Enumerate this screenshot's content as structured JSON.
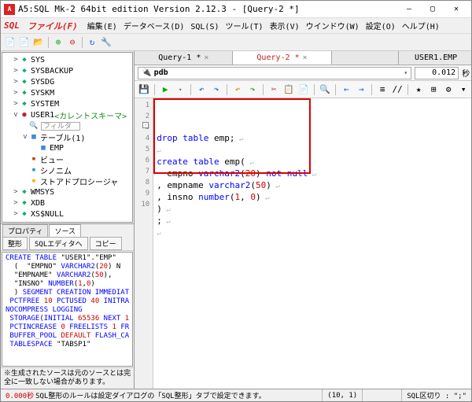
{
  "window": {
    "icon_letter": "A",
    "title": "A5:SQL Mk-2 64bit edition Version 2.12.3 - [Query-2 *]",
    "btn_min": "—",
    "btn_max": "▢",
    "btn_close": "✕"
  },
  "menubar": {
    "logo": "SQL",
    "items": [
      "ファイル(F)",
      "編集(E)",
      "データベース(D)",
      "SQL(S)",
      "ツール(T)",
      "表示(V)",
      "ウインドウ(W)",
      "設定(O)",
      "ヘルプ(H)"
    ]
  },
  "tree": {
    "nodes": [
      {
        "indent": 1,
        "tw": ">",
        "icon": "db",
        "label": "SYS"
      },
      {
        "indent": 1,
        "tw": ">",
        "icon": "db",
        "label": "SYSBACKUP"
      },
      {
        "indent": 1,
        "tw": ">",
        "icon": "db",
        "label": "SYSDG"
      },
      {
        "indent": 1,
        "tw": ">",
        "icon": "db",
        "label": "SYSKM"
      },
      {
        "indent": 1,
        "tw": ">",
        "icon": "db",
        "label": "SYSTEM"
      },
      {
        "indent": 1,
        "tw": "v",
        "icon": "user",
        "label": "USER1",
        "suffix": " <カレントスキーマ>",
        "suffixClass": "green-txt"
      },
      {
        "indent": 2,
        "tw": "",
        "icon": "lens",
        "label": "",
        "filter": "フィルタ"
      },
      {
        "indent": 2,
        "tw": "v",
        "icon": "tbl",
        "label": "テーブル(1)"
      },
      {
        "indent": 3,
        "tw": "",
        "icon": "tbl",
        "label": "EMP"
      },
      {
        "indent": 2,
        "tw": "",
        "icon": "obj",
        "label": "ビュー",
        "iconColor": "#b40"
      },
      {
        "indent": 2,
        "tw": "",
        "icon": "obj",
        "label": "シノニム",
        "iconColor": "#29c"
      },
      {
        "indent": 2,
        "tw": "",
        "icon": "obj",
        "label": "ストアドプロシージャ",
        "iconColor": "#fa0"
      },
      {
        "indent": 1,
        "tw": ">",
        "icon": "db",
        "label": "WMSYS"
      },
      {
        "indent": 1,
        "tw": ">",
        "icon": "db",
        "label": "XDB"
      },
      {
        "indent": 1,
        "tw": ">",
        "icon": "db",
        "label": "XS$NULL"
      }
    ]
  },
  "prop": {
    "tabs": [
      "プロパティ",
      "ソース"
    ],
    "active_tab": 1,
    "buttons": [
      "整形",
      "SQLエディタへ",
      "コピー"
    ],
    "source_lines": [
      {
        "t": "CREATE TABLE ",
        "c": "kw-blue"
      },
      {
        "t": "\"USER1\".\"EMP\"",
        "c": ""
      },
      {
        "br": 1
      },
      {
        "t": "  (  \"EMPNO\" ",
        "c": ""
      },
      {
        "t": "VARCHAR2",
        "c": "kw-blue"
      },
      {
        "t": "(",
        "c": ""
      },
      {
        "t": "20",
        "c": "kw-red"
      },
      {
        "t": ") N",
        "c": ""
      },
      {
        "br": 1
      },
      {
        "t": "  \"EMPNAME\" ",
        "c": ""
      },
      {
        "t": "VARCHAR2",
        "c": "kw-blue"
      },
      {
        "t": "(",
        "c": ""
      },
      {
        "t": "50",
        "c": "kw-red"
      },
      {
        "t": "),",
        "c": ""
      },
      {
        "br": 1
      },
      {
        "t": "  \"INSNO\" ",
        "c": ""
      },
      {
        "t": "NUMBER",
        "c": "kw-blue"
      },
      {
        "t": "(",
        "c": ""
      },
      {
        "t": "1",
        "c": "kw-red"
      },
      {
        "t": ",",
        "c": ""
      },
      {
        "t": "0",
        "c": "kw-red"
      },
      {
        "t": ")",
        "c": ""
      },
      {
        "br": 1
      },
      {
        "t": "  ) ",
        "c": ""
      },
      {
        "t": "SEGMENT CREATION IMMEDIAT",
        "c": "kw-blue"
      },
      {
        "br": 1
      },
      {
        "t": " PCTFREE ",
        "c": "kw-blue"
      },
      {
        "t": "10",
        "c": "kw-red"
      },
      {
        "t": " PCTUSED ",
        "c": "kw-blue"
      },
      {
        "t": "40",
        "c": "kw-red"
      },
      {
        "t": " INITRA",
        "c": "kw-blue"
      },
      {
        "br": 1
      },
      {
        "t": "NOCOMPRESS LOGGING",
        "c": "kw-blue"
      },
      {
        "br": 1
      },
      {
        "t": " STORAGE",
        "c": "kw-blue"
      },
      {
        "t": "(",
        "c": ""
      },
      {
        "t": "INITIAL ",
        "c": "kw-blue"
      },
      {
        "t": "65536",
        "c": "kw-red"
      },
      {
        "t": " NEXT ",
        "c": "kw-blue"
      },
      {
        "t": "1",
        "c": "kw-red"
      },
      {
        "br": 1
      },
      {
        "t": " PCTINCREASE ",
        "c": "kw-blue"
      },
      {
        "t": "0",
        "c": "kw-red"
      },
      {
        "t": " FREELISTS ",
        "c": "kw-blue"
      },
      {
        "t": "1",
        "c": "kw-red"
      },
      {
        "t": " FR",
        "c": "kw-blue"
      },
      {
        "br": 1
      },
      {
        "t": " BUFFER_POOL ",
        "c": "kw-blue"
      },
      {
        "t": "DEFAULT",
        "c": "kw-red"
      },
      {
        "t": " FLASH_CA",
        "c": "kw-blue"
      },
      {
        "br": 1
      },
      {
        "t": " TABLESPACE ",
        "c": "kw-blue"
      },
      {
        "t": "\"TABSP1\"",
        "c": ""
      }
    ],
    "note": "※生成されたソースは元のソースとは完全に一致しない場合があります。"
  },
  "editor": {
    "tabs": [
      {
        "label": "Query-1 *",
        "active": false
      },
      {
        "label": "Query-2 *",
        "active": true
      }
    ],
    "right_tab": "USER1.EMP",
    "conn": {
      "name": "pdb"
    },
    "time_value": "0.012",
    "time_unit": "秒",
    "gutter": [
      "1",
      "2",
      "3",
      "4",
      "5",
      "6",
      "7",
      "8",
      "9",
      "10"
    ],
    "tokens": [
      [
        {
          "t": "drop table",
          "c": "kw-blue"
        },
        {
          "t": " emp;",
          "c": ""
        },
        {
          "t": " ↵",
          "c": "eol"
        }
      ],
      [
        {
          "t": "↵",
          "c": "eol"
        }
      ],
      [
        {
          "t": "create table",
          "c": "kw-blue"
        },
        {
          "t": " emp(",
          "c": ""
        },
        {
          "t": " ↵",
          "c": "eol"
        }
      ],
      [
        {
          "t": "  empno ",
          "c": ""
        },
        {
          "t": "varchar2",
          "c": "kw-blue"
        },
        {
          "t": "(",
          "c": ""
        },
        {
          "t": "20",
          "c": "kw-red"
        },
        {
          "t": ") ",
          "c": ""
        },
        {
          "t": "not null",
          "c": "kw-blue"
        },
        {
          "t": " ↵",
          "c": "eol"
        }
      ],
      [
        {
          "t": ", empname ",
          "c": ""
        },
        {
          "t": "varchar2",
          "c": "kw-blue"
        },
        {
          "t": "(",
          "c": ""
        },
        {
          "t": "50",
          "c": "kw-red"
        },
        {
          "t": ")",
          "c": ""
        },
        {
          "t": " ↵",
          "c": "eol"
        }
      ],
      [
        {
          "t": ", insno ",
          "c": ""
        },
        {
          "t": "number",
          "c": "kw-blue"
        },
        {
          "t": "(",
          "c": ""
        },
        {
          "t": "1",
          "c": "kw-red"
        },
        {
          "t": ", ",
          "c": ""
        },
        {
          "t": "0",
          "c": "kw-red"
        },
        {
          "t": ")",
          "c": ""
        },
        {
          "t": " ↵",
          "c": "eol"
        }
      ],
      [
        {
          "t": ")",
          "c": ""
        },
        {
          "t": " ↵",
          "c": "eol"
        }
      ],
      [
        {
          "t": ";",
          "c": ""
        },
        {
          "t": " ↵",
          "c": "eol"
        }
      ],
      [
        {
          "t": "↵",
          "c": "eol"
        }
      ],
      []
    ]
  },
  "status": {
    "time": "0.000秒",
    "msg": " SQL整形のルールは設定ダイアログの「SQL整形」タブで設定できます。",
    "pos": "(10, 1)",
    "sep": "SQL区切り : \";\""
  }
}
